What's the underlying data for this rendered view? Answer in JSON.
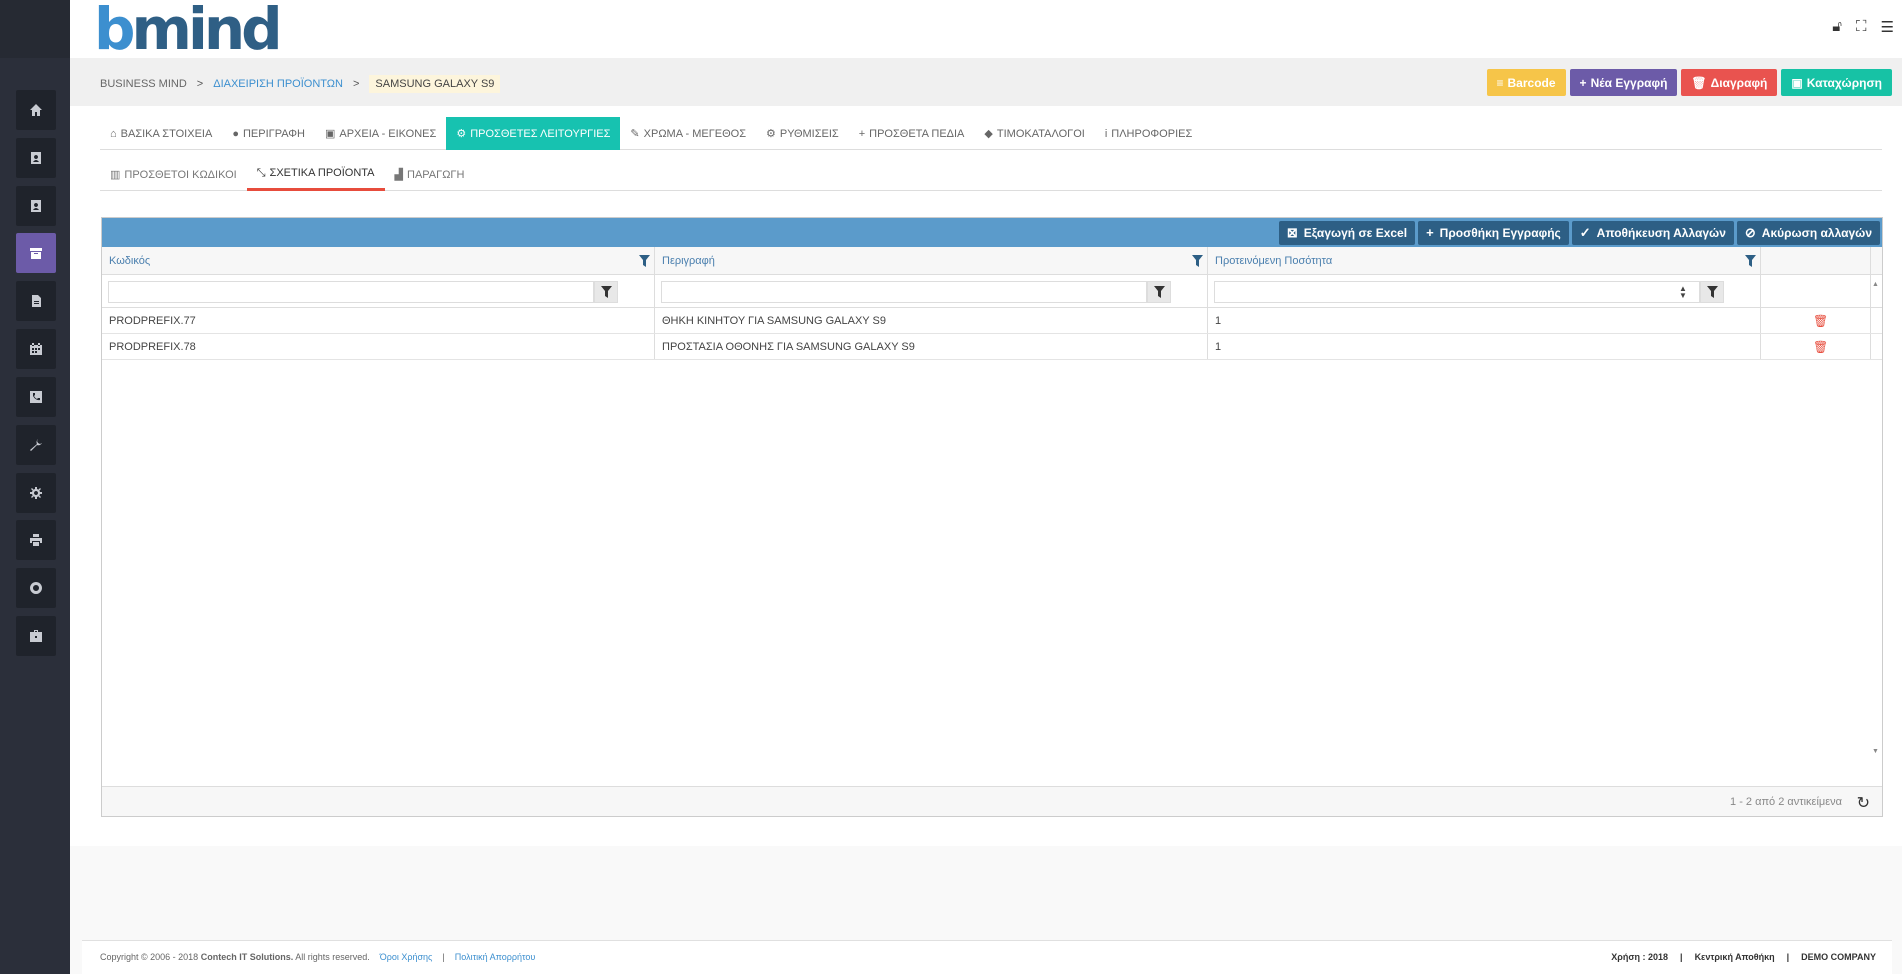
{
  "brand": {
    "logo_b": "b",
    "logo_rest": "mind"
  },
  "header_icons": [
    "lock-open-icon",
    "fullscreen-icon",
    "menu-add-icon"
  ],
  "sidebar": {
    "items": [
      {
        "icon": "home-icon",
        "active": false
      },
      {
        "icon": "contact-book-icon",
        "active": false
      },
      {
        "icon": "address-card-icon",
        "active": false
      },
      {
        "icon": "archive-box-icon",
        "active": true
      },
      {
        "icon": "document-icon",
        "active": false
      },
      {
        "icon": "calendar-icon",
        "active": false
      },
      {
        "icon": "phone-icon",
        "active": false
      },
      {
        "icon": "wrench-icon",
        "active": false
      },
      {
        "icon": "gear-icon",
        "active": false
      },
      {
        "icon": "printer-icon",
        "active": false
      },
      {
        "icon": "lifebuoy-icon",
        "active": false
      },
      {
        "icon": "toolbox-icon",
        "active": false
      }
    ]
  },
  "breadcrumb": {
    "root": "BUSINESS MIND",
    "section": "ΔΙΑΧΕΙΡΙΣΗ ΠΡΟΪΟΝΤΩΝ",
    "current": "SAMSUNG GALAXY S9",
    "separator": ">"
  },
  "actions": {
    "barcode": "Barcode",
    "new": "Νέα Εγγραφή",
    "delete": "Διαγραφή",
    "save": "Καταχώρηση"
  },
  "tabs": [
    {
      "label": "ΒΑΣΙΚΑ ΣΤΟΙΧΕΙΑ",
      "icon": "home-icon",
      "glyph": "⌂"
    },
    {
      "label": "ΠΕΡΙΓΡΑΦΗ",
      "icon": "comment-icon",
      "glyph": "●"
    },
    {
      "label": "ΑΡΧΕΙΑ - ΕΙΚΟΝΕΣ",
      "icon": "image-file-icon",
      "glyph": "▣"
    },
    {
      "label": "ΠΡΟΣΘΕΤΕΣ ΛΕΙΤΟΥΡΓΙΕΣ",
      "icon": "cogs-icon",
      "glyph": "⚙",
      "active": true
    },
    {
      "label": "ΧΡΩΜΑ - ΜΕΓΕΘΟΣ",
      "icon": "brush-icon",
      "glyph": "✎"
    },
    {
      "label": "ΡΥΘΜΙΣΕΙΣ",
      "icon": "gear-icon",
      "glyph": "⚙"
    },
    {
      "label": "ΠΡΟΣΘΕΤΑ ΠΕΔΙΑ",
      "icon": "plus-icon",
      "glyph": "+"
    },
    {
      "label": "ΤΙΜΟΚΑΤΑΛΟΓΟΙ",
      "icon": "tag-icon",
      "glyph": "◆"
    },
    {
      "label": "ΠΛΗΡΟΦΟΡΙΕΣ",
      "icon": "info-icon",
      "glyph": "i"
    }
  ],
  "subtabs": [
    {
      "label": "ΠΡΟΣΘΕΤΟΙ ΚΩΔΙΚΟΙ",
      "icon": "barcode-icon",
      "glyph": "▥"
    },
    {
      "label": "ΣΧΕΤΙΚΑ ΠΡΟΪΟΝΤΑ",
      "icon": "compress-icon",
      "glyph": "⤡",
      "active": true
    },
    {
      "label": "ΠΑΡΑΓΩΓΗ",
      "icon": "industry-icon",
      "glyph": "▟"
    }
  ],
  "grid": {
    "toolbar": {
      "export": "Εξαγωγή σε Excel",
      "add": "Προσθήκη Εγγραφής",
      "save_changes": "Αποθήκευση Αλλαγών",
      "cancel_changes": "Ακύρωση αλλαγών"
    },
    "columns": [
      "Κωδικός",
      "Περιγραφή",
      "Προτεινόμενη Ποσότητα"
    ],
    "rows": [
      {
        "code": "PRODPREFIX.77",
        "description": "ΘΗΚΗ ΚΙΝΗΤΟΥ ΓΙΑ SAMSUNG GALAXY S9",
        "qty": "1"
      },
      {
        "code": "PRODPREFIX.78",
        "description": "ΠΡΟΣΤΑΣΙΑ ΟΘΟΝΗΣ ΓΙΑ SAMSUNG GALAXY S9",
        "qty": "1"
      }
    ],
    "pager_info": "1 - 2 από 2 αντικείμενα"
  },
  "footer": {
    "copyright": "Copyright © 2006 - 2018",
    "company": "Contech IT Solutions.",
    "rights": "All rights reserved.",
    "terms": "Όροι Χρήσης",
    "privacy": "Πολιτική Απορρήτου",
    "year": "Χρήση : 2018",
    "warehouse": "Κεντρική Αποθήκη",
    "demo": "DEMO COMPANY",
    "sep": "|"
  },
  "colors": {
    "sidebar_bg": "#2b2f3a",
    "sidebar_active": "#6c5ba8",
    "tab_active": "#17c2b0",
    "grid_toolbar": "#5b9bcb",
    "grid_button": "#2d5f85",
    "barcode": "#f6c549",
    "new": "#6c5ba8",
    "delete": "#e9534f",
    "save": "#17c2a5",
    "subtab_underline": "#e74c3c"
  }
}
